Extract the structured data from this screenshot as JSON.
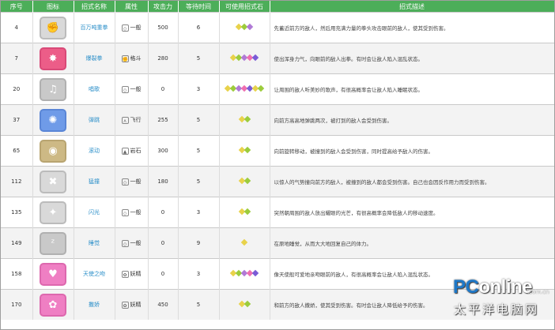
{
  "headers": [
    "序号",
    "图标",
    "招式名称",
    "属性",
    "攻击力",
    "等待时间",
    "可使用招式石",
    "招式描述"
  ],
  "rows": [
    {
      "id": "4",
      "name": "百万吨重拳",
      "attr": "一般",
      "attr_icon": "diamond-icon",
      "atk": "500",
      "wait": "6",
      "stones": [
        "#e8d24a",
        "#9ccc3c",
        "#b07ad6"
      ],
      "icon_bg": "#d9d9d9",
      "icon_border": "#bbbbbb",
      "icon_glyph": "fist",
      "desc": "先蓄近前方的敌人，然后用充满力量的拳头攻击眼前的敌人，使其受到伤害。"
    },
    {
      "id": "7",
      "name": "爆裂拳",
      "attr": "格斗",
      "attr_icon": "fist-icon",
      "atk": "280",
      "wait": "5",
      "stones": [
        "#e8d24a",
        "#9ccc3c",
        "#b07ad6",
        "#ef6fb0",
        "#7a5bd6"
      ],
      "icon_bg": "#ec5d88",
      "icon_border": "#d94a78",
      "icon_glyph": "burst",
      "desc": "使出浑身力气，向眼前的敌人出拳。有时会让敌人陷入混乱状态。"
    },
    {
      "id": "20",
      "name": "唱歌",
      "attr": "一般",
      "attr_icon": "diamond-icon",
      "atk": "0",
      "wait": "3",
      "stones": [
        "#e8d24a",
        "#9ccc3c",
        "#b07ad6",
        "#ef6fb0",
        "#7a5bd6",
        "#e8d24a",
        "#9ccc3c"
      ],
      "icon_bg": "#c9c9c9",
      "icon_border": "#b0b0b0",
      "icon_glyph": "note",
      "desc": "让周围的敌人听美妙的歌声，有很高概率会让敌人陷入睡眠状态。"
    },
    {
      "id": "37",
      "name": "弹跳",
      "attr": "飞行",
      "attr_icon": "wing-icon",
      "atk": "255",
      "wait": "5",
      "stones": [
        "#e8d24a",
        "#9ccc3c"
      ],
      "icon_bg": "#6f9be8",
      "icon_border": "#5a86d6",
      "icon_glyph": "splash",
      "desc": "向前方高高地弹跳两次，被打到的敌人会受到伤害。"
    },
    {
      "id": "65",
      "name": "滚动",
      "attr": "岩石",
      "attr_icon": "rock-icon",
      "atk": "300",
      "wait": "5",
      "stones": [
        "#e8d24a",
        "#9ccc3c"
      ],
      "icon_bg": "#cdb985",
      "icon_border": "#b8a470",
      "icon_glyph": "roll",
      "desc": "向前旋转移动，被撞到的敌人会受到伤害，同时提高给予敌人的伤害。"
    },
    {
      "id": "112",
      "name": "猛撞",
      "attr": "一般",
      "attr_icon": "diamond-icon",
      "atk": "180",
      "wait": "5",
      "stones": [
        "#e8d24a",
        "#9ccc3c"
      ],
      "icon_bg": "#d9d9d9",
      "icon_border": "#bbbbbb",
      "icon_glyph": "cross",
      "desc": "以惊人的气势撞向前方的敌人，被撞到的敌人都会受到伤害。自己也会因反作用力而受到伤害。"
    },
    {
      "id": "135",
      "name": "闪光",
      "attr": "一般",
      "attr_icon": "diamond-icon",
      "atk": "0",
      "wait": "3",
      "stones": [
        "#e8d24a",
        "#9ccc3c"
      ],
      "icon_bg": "#d9d9d9",
      "icon_border": "#bbbbbb",
      "icon_glyph": "flash",
      "desc": "突然朝周围的敌人放出耀眼的光芒，有很高概率会降低敌人的移动速度。"
    },
    {
      "id": "149",
      "name": "睡觉",
      "attr": "一般",
      "attr_icon": "diamond-icon",
      "atk": "0",
      "wait": "9",
      "stones": [
        "#e8d24a"
      ],
      "icon_bg": "#c9c9c9",
      "icon_border": "#b0b0b0",
      "icon_glyph": "sleep",
      "desc": "在原地睡觉，从而大大地回复自己的体力。"
    },
    {
      "id": "158",
      "name": "天使之吻",
      "attr": "妖精",
      "attr_icon": "fairy-icon",
      "atk": "0",
      "wait": "3",
      "stones": [
        "#e8d24a",
        "#9ccc3c",
        "#b07ad6",
        "#ef6fb0",
        "#7a5bd6"
      ],
      "icon_bg": "#ef7fc3",
      "icon_border": "#dd68ae",
      "icon_glyph": "kiss",
      "desc": "像天使般可爱地亲吻眼前的敌人，有很高概率会让敌人陷入混乱状态。"
    },
    {
      "id": "170",
      "name": "撒娇",
      "attr": "妖精",
      "attr_icon": "fairy-icon",
      "atk": "450",
      "wait": "5",
      "stones": [
        "#e8d24a",
        "#9ccc3c"
      ],
      "icon_bg": "#ef7fc3",
      "icon_border": "#dd68ae",
      "icon_glyph": "cute",
      "desc": "和前方的敌人撒娇，使其受到伤害。有时会让敌人降低给予的伤害。"
    }
  ],
  "watermark": {
    "brand_pc": "PC",
    "brand_online": "online",
    "domain": ".com.cn",
    "cn": "太平洋电脑网"
  },
  "colors": {
    "header_bg": "#4cae59",
    "name_link": "#2b8fc9"
  }
}
